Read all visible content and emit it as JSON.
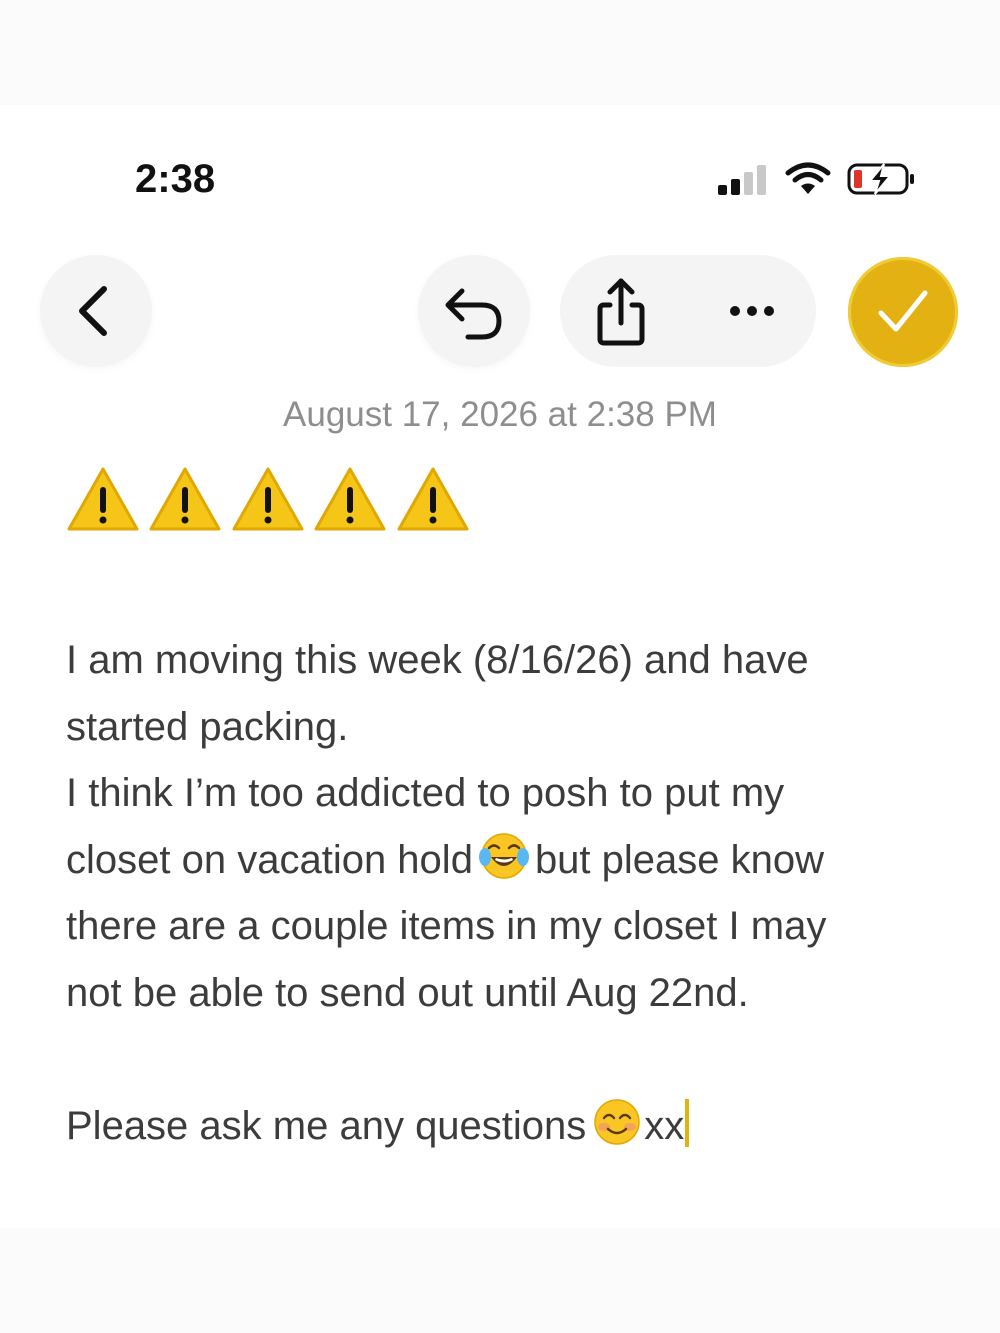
{
  "status_bar": {
    "time": "2:38",
    "signal_icon": "cellular-signal-icon",
    "wifi_icon": "wifi-icon",
    "battery_icon": "battery-charging-icon"
  },
  "toolbar": {
    "back_icon": "chevron-left-icon",
    "undo_icon": "undo-icon",
    "share_icon": "share-icon",
    "more_icon": "ellipsis-icon",
    "done_icon": "checkmark-icon",
    "accent_color": "#e3b212"
  },
  "note": {
    "date": "August 17, 2026 at 2:38 PM",
    "warning_emoji_count": 5,
    "lines": [
      "I am moving this week (8/16/26) and have",
      "started packing.",
      "I think I’m too addicted to posh to put my"
    ],
    "line4_before_emoji": "closet on vacation hold",
    "line4_after_emoji": "but please know",
    "line5": "there are a couple items in my closet I may",
    "line6": "not be able to send out until Aug 22nd.",
    "closing_text": "Please ask me any questions",
    "closing_suffix": "xx",
    "emoji_laughing": "tears-of-joy-emoji",
    "emoji_smile": "smiling-face-emoji"
  }
}
